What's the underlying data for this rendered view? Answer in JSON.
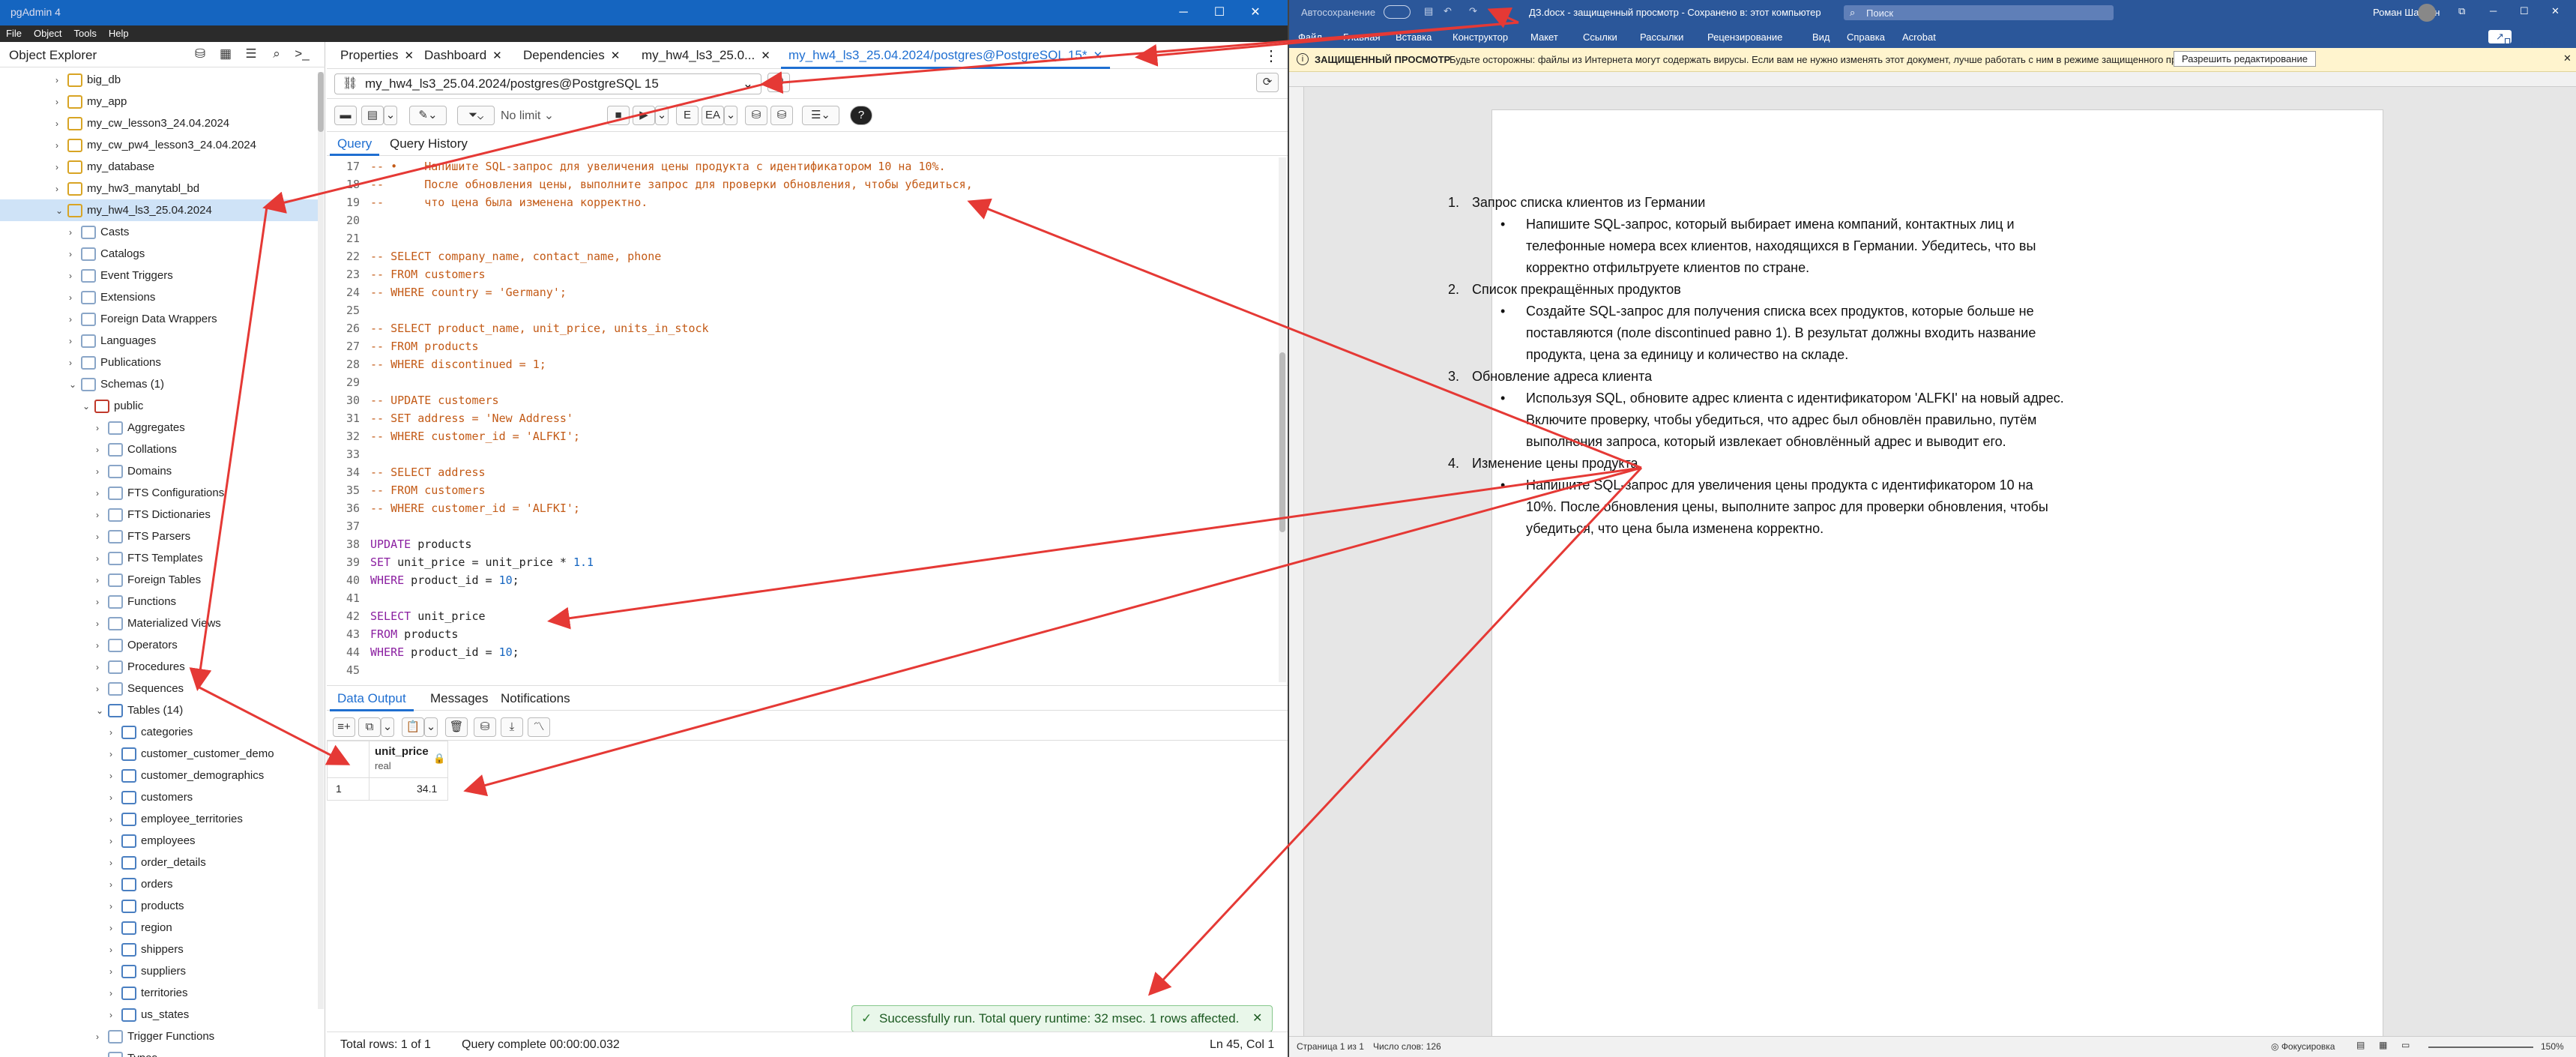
{
  "pgadmin": {
    "window_title": "pgAdmin 4",
    "menu": [
      "File",
      "Object",
      "Tools",
      "Help"
    ],
    "object_explorer_title": "Object Explorer",
    "tree": [
      {
        "label": "big_db",
        "depth": 3,
        "icon": "database-icon",
        "chev": "›"
      },
      {
        "label": "my_app",
        "depth": 3,
        "icon": "database-icon",
        "chev": "›"
      },
      {
        "label": "my_cw_lesson3_24.04.2024",
        "depth": 3,
        "icon": "database-icon",
        "chev": "›"
      },
      {
        "label": "my_cw_pw4_lesson3_24.04.2024",
        "depth": 3,
        "icon": "database-icon",
        "chev": "›"
      },
      {
        "label": "my_database",
        "depth": 3,
        "icon": "database-icon",
        "chev": "›"
      },
      {
        "label": "my_hw3_manytabl_bd",
        "depth": 3,
        "icon": "database-icon",
        "chev": "›"
      },
      {
        "label": "my_hw4_ls3_25.04.2024",
        "depth": 3,
        "icon": "database-icon",
        "chev": "⌄",
        "selected": true
      },
      {
        "label": "Casts",
        "depth": 4,
        "icon": "casts-icon",
        "chev": "›"
      },
      {
        "label": "Catalogs",
        "depth": 4,
        "icon": "catalogs-icon",
        "chev": "›"
      },
      {
        "label": "Event Triggers",
        "depth": 4,
        "icon": "event-triggers-icon",
        "chev": "›"
      },
      {
        "label": "Extensions",
        "depth": 4,
        "icon": "extensions-icon",
        "chev": "›"
      },
      {
        "label": "Foreign Data Wrappers",
        "depth": 4,
        "icon": "fdw-icon",
        "chev": "›"
      },
      {
        "label": "Languages",
        "depth": 4,
        "icon": "languages-icon",
        "chev": "›"
      },
      {
        "label": "Publications",
        "depth": 4,
        "icon": "publications-icon",
        "chev": "›"
      },
      {
        "label": "Schemas (1)",
        "depth": 4,
        "icon": "schemas-icon",
        "chev": "⌄"
      },
      {
        "label": "public",
        "depth": 5,
        "icon": "schema-icon",
        "chev": "⌄"
      },
      {
        "label": "Aggregates",
        "depth": 6,
        "icon": "aggregates-icon",
        "chev": "›"
      },
      {
        "label": "Collations",
        "depth": 6,
        "icon": "collations-icon",
        "chev": "›"
      },
      {
        "label": "Domains",
        "depth": 6,
        "icon": "domains-icon",
        "chev": "›"
      },
      {
        "label": "FTS Configurations",
        "depth": 6,
        "icon": "fts-config-icon",
        "chev": "›"
      },
      {
        "label": "FTS Dictionaries",
        "depth": 6,
        "icon": "fts-dict-icon",
        "chev": "›"
      },
      {
        "label": "FTS Parsers",
        "depth": 6,
        "icon": "fts-parsers-icon",
        "chev": "›"
      },
      {
        "label": "FTS Templates",
        "depth": 6,
        "icon": "fts-templates-icon",
        "chev": "›"
      },
      {
        "label": "Foreign Tables",
        "depth": 6,
        "icon": "foreign-tables-icon",
        "chev": "›"
      },
      {
        "label": "Functions",
        "depth": 6,
        "icon": "functions-icon",
        "chev": "›"
      },
      {
        "label": "Materialized Views",
        "depth": 6,
        "icon": "mat-views-icon",
        "chev": "›"
      },
      {
        "label": "Operators",
        "depth": 6,
        "icon": "operators-icon",
        "chev": "›"
      },
      {
        "label": "Procedures",
        "depth": 6,
        "icon": "procedures-icon",
        "chev": "›"
      },
      {
        "label": "Sequences",
        "depth": 6,
        "icon": "sequences-icon",
        "chev": "›"
      },
      {
        "label": "Tables (14)",
        "depth": 6,
        "icon": "tables-icon",
        "chev": "⌄"
      },
      {
        "label": "categories",
        "depth": 7,
        "icon": "table-icon",
        "chev": "›"
      },
      {
        "label": "customer_customer_demo",
        "depth": 7,
        "icon": "table-icon",
        "chev": "›"
      },
      {
        "label": "customer_demographics",
        "depth": 7,
        "icon": "table-icon",
        "chev": "›"
      },
      {
        "label": "customers",
        "depth": 7,
        "icon": "table-icon",
        "chev": "›"
      },
      {
        "label": "employee_territories",
        "depth": 7,
        "icon": "table-icon",
        "chev": "›"
      },
      {
        "label": "employees",
        "depth": 7,
        "icon": "table-icon",
        "chev": "›"
      },
      {
        "label": "order_details",
        "depth": 7,
        "icon": "table-icon",
        "chev": "›"
      },
      {
        "label": "orders",
        "depth": 7,
        "icon": "table-icon",
        "chev": "›"
      },
      {
        "label": "products",
        "depth": 7,
        "icon": "table-icon",
        "chev": "›"
      },
      {
        "label": "region",
        "depth": 7,
        "icon": "table-icon",
        "chev": "›"
      },
      {
        "label": "shippers",
        "depth": 7,
        "icon": "table-icon",
        "chev": "›"
      },
      {
        "label": "suppliers",
        "depth": 7,
        "icon": "table-icon",
        "chev": "›"
      },
      {
        "label": "territories",
        "depth": 7,
        "icon": "table-icon",
        "chev": "›"
      },
      {
        "label": "us_states",
        "depth": 7,
        "icon": "table-icon",
        "chev": "›"
      },
      {
        "label": "Trigger Functions",
        "depth": 6,
        "icon": "trigger-functions-icon",
        "chev": "›"
      },
      {
        "label": "Types",
        "depth": 6,
        "icon": "types-icon",
        "chev": "›"
      }
    ],
    "tabs": [
      {
        "label": "Properties",
        "close": "✕"
      },
      {
        "label": "Dashboard",
        "close": "✕"
      },
      {
        "label": "Dependencies",
        "close": "✕"
      },
      {
        "label": "my_hw4_ls3_25.0...",
        "close": "✕"
      },
      {
        "label": "my_hw4_ls3_25.04.2024/postgres@PostgreSQL 15*",
        "close": "✕",
        "active": true
      }
    ],
    "connection": "my_hw4_ls3_25.04.2024/postgres@PostgreSQL 15",
    "limit": "No limit",
    "query_tabs": [
      "Query",
      "Query History"
    ],
    "code_lines": [
      {
        "n": "17",
        "cls": "cm",
        "text": "-- •    Напишите SQL-запрос для увеличения цены продукта с идентификатором 10 на 10%."
      },
      {
        "n": "18",
        "cls": "cm",
        "text": "--      После обновления цены, выполните запрос для проверки обновления, чтобы убедиться,"
      },
      {
        "n": "19",
        "cls": "cm",
        "text": "--      что цена была изменена корректно."
      },
      {
        "n": "20",
        "cls": "",
        "text": ""
      },
      {
        "n": "21",
        "cls": "",
        "text": ""
      },
      {
        "n": "22",
        "cls": "cm",
        "text": "-- SELECT company_name, contact_name, phone"
      },
      {
        "n": "23",
        "cls": "cm",
        "text": "-- FROM customers"
      },
      {
        "n": "24",
        "cls": "cm",
        "text": "-- WHERE country = 'Germany';"
      },
      {
        "n": "25",
        "cls": "",
        "text": ""
      },
      {
        "n": "26",
        "cls": "cm",
        "text": "-- SELECT product_name, unit_price, units_in_stock"
      },
      {
        "n": "27",
        "cls": "cm",
        "text": "-- FROM products"
      },
      {
        "n": "28",
        "cls": "cm",
        "text": "-- WHERE discontinued = 1;"
      },
      {
        "n": "29",
        "cls": "",
        "text": ""
      },
      {
        "n": "30",
        "cls": "cm",
        "text": "-- UPDATE customers"
      },
      {
        "n": "31",
        "cls": "cm",
        "text": "-- SET address = 'New Address'"
      },
      {
        "n": "32",
        "cls": "cm",
        "text": "-- WHERE customer_id = 'ALFKI';"
      },
      {
        "n": "33",
        "cls": "",
        "text": ""
      },
      {
        "n": "34",
        "cls": "cm",
        "text": "-- SELECT address"
      },
      {
        "n": "35",
        "cls": "cm",
        "text": "-- FROM customers"
      },
      {
        "n": "36",
        "cls": "cm",
        "text": "-- WHERE customer_id = 'ALFKI';"
      },
      {
        "n": "37",
        "cls": "",
        "text": ""
      },
      {
        "n": "38",
        "cls": "sql",
        "kw": "UPDATE",
        "text": " products"
      },
      {
        "n": "39",
        "cls": "sql",
        "kw": "SET",
        "text": " unit_price = unit_price * ",
        "num": "1.1"
      },
      {
        "n": "40",
        "cls": "sql",
        "kw": "WHERE",
        "text": " product_id = ",
        "num": "10",
        "tail": ";"
      },
      {
        "n": "41",
        "cls": "",
        "text": ""
      },
      {
        "n": "42",
        "cls": "sql",
        "kw": "SELECT",
        "text": " unit_price"
      },
      {
        "n": "43",
        "cls": "sql",
        "kw": "FROM",
        "text": " products"
      },
      {
        "n": "44",
        "cls": "sql",
        "kw": "WHERE",
        "text": " product_id = ",
        "num": "10",
        "tail": ";"
      },
      {
        "n": "45",
        "cls": "",
        "text": ""
      }
    ],
    "output_tabs": [
      "Data Output",
      "Messages",
      "Notifications"
    ],
    "result": {
      "column": "unit_price",
      "type": "real",
      "row_num": "1",
      "value": "34.1"
    },
    "toast": "Successfully run. Total query runtime: 32 msec. 1 rows affected.",
    "status": {
      "rows": "Total rows: 1 of 1",
      "complete": "Query complete 00:00:00.032",
      "cursor": "Ln 45, Col 1"
    }
  },
  "word": {
    "autosave": "Автосохранение",
    "title": "ДЗ.docx - защищенный просмотр - Сохранено в: этот компьютер",
    "search": "Поиск",
    "user": "Роман Шаунин",
    "share": "Поделиться",
    "ribbon": [
      "Файл",
      "Главная",
      "Вставка",
      "Конструктор",
      "Макет",
      "Ссылки",
      "Рассылки",
      "Рецензирование",
      "Вид",
      "Справка",
      "Acrobat"
    ],
    "warn_label": "ЗАЩИЩЕННЫЙ ПРОСМОТР",
    "warn_text": "Будьте осторожны: файлы из Интернета могут содержать вирусы. Если вам не нужно изменять этот документ, лучше работать с ним в режиме защищенного просмотра.",
    "warn_button": "Разрешить редактирование",
    "doc": [
      {
        "k": "num",
        "marker": "1.",
        "text": "Запрос списка клиентов из Германии"
      },
      {
        "k": "bul",
        "marker": "•",
        "text": "Напишите SQL-запрос, который выбирает имена компаний, контактных лиц и"
      },
      {
        "k": "cont",
        "text": "телефонные номера всех клиентов, находящихся в Германии. Убедитесь, что вы"
      },
      {
        "k": "cont",
        "text": "корректно отфильтруете клиентов по стране."
      },
      {
        "k": "num",
        "marker": "2.",
        "text": "Список прекращённых продуктов"
      },
      {
        "k": "bul",
        "marker": "•",
        "text": "Создайте SQL-запрос для получения списка всех продуктов, которые больше не"
      },
      {
        "k": "cont",
        "text": "поставляются (поле discontinued равно 1). В результат должны входить название"
      },
      {
        "k": "cont",
        "text": "продукта, цена за единицу и количество на складе."
      },
      {
        "k": "num",
        "marker": "3.",
        "text": "Обновление адреса клиента"
      },
      {
        "k": "bul",
        "marker": "•",
        "text": "Используя SQL, обновите адрес клиента с идентификатором 'ALFKI' на новый адрес."
      },
      {
        "k": "cont",
        "text": "Включите проверку, чтобы убедиться, что адрес был обновлён правильно, путём"
      },
      {
        "k": "cont",
        "text": "выполнения запроса, который извлекает обновлённый адрес и выводит его."
      },
      {
        "k": "num",
        "marker": "4.",
        "text": "Изменение цены продукта"
      },
      {
        "k": "bul",
        "marker": "•",
        "text": "Напишите SQL-запрос для увеличения цены продукта с идентификатором 10 на"
      },
      {
        "k": "cont",
        "text": "10%. После обновления цены, выполните запрос для проверки обновления, чтобы"
      },
      {
        "k": "cont",
        "text": "убедиться, что цена была изменена корректно."
      }
    ],
    "status_page": "Страница 1 из 1",
    "status_words": "Число слов: 126",
    "focus": "Фокусировка",
    "zoom": "150%"
  },
  "colors": {
    "annotation": "#e53935",
    "pg_accent": "#1f6fd1",
    "word_blue": "#2b579a"
  }
}
